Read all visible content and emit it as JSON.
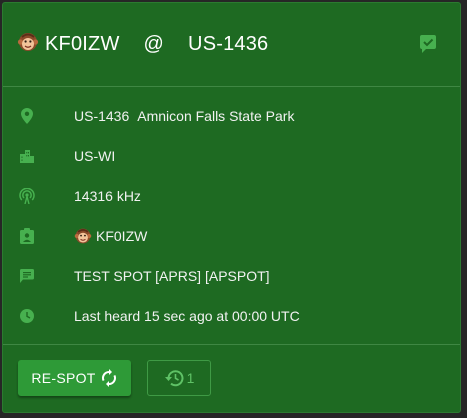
{
  "header": {
    "callsign": "KF0IZW",
    "at": "@",
    "park": "US-1436",
    "avatar_icon": "monkey-avatar-icon",
    "status_icon": "checkbox-checked-icon"
  },
  "details": {
    "location": {
      "icon": "location-pin-icon",
      "code": "US-1436",
      "name": "Amnicon Falls State Park"
    },
    "region": {
      "icon": "city-icon",
      "text": "US-WI"
    },
    "frequency": {
      "icon": "antenna-icon",
      "text": "14316 kHz"
    },
    "spotter": {
      "icon": "contact-badge-icon",
      "text": "KF0IZW"
    },
    "comment": {
      "icon": "chat-icon",
      "text": "TEST SPOT [APRS] [APSPOT]"
    },
    "last_heard": {
      "icon": "clock-icon",
      "text": "Last heard 15 sec ago at 00:00 UTC"
    }
  },
  "footer": {
    "respot_label": "RE-SPOT",
    "history_count": "1"
  },
  "colors": {
    "card_bg": "#1e6a22",
    "icon_green": "#47b04f",
    "button_bg": "#2e9a37"
  }
}
